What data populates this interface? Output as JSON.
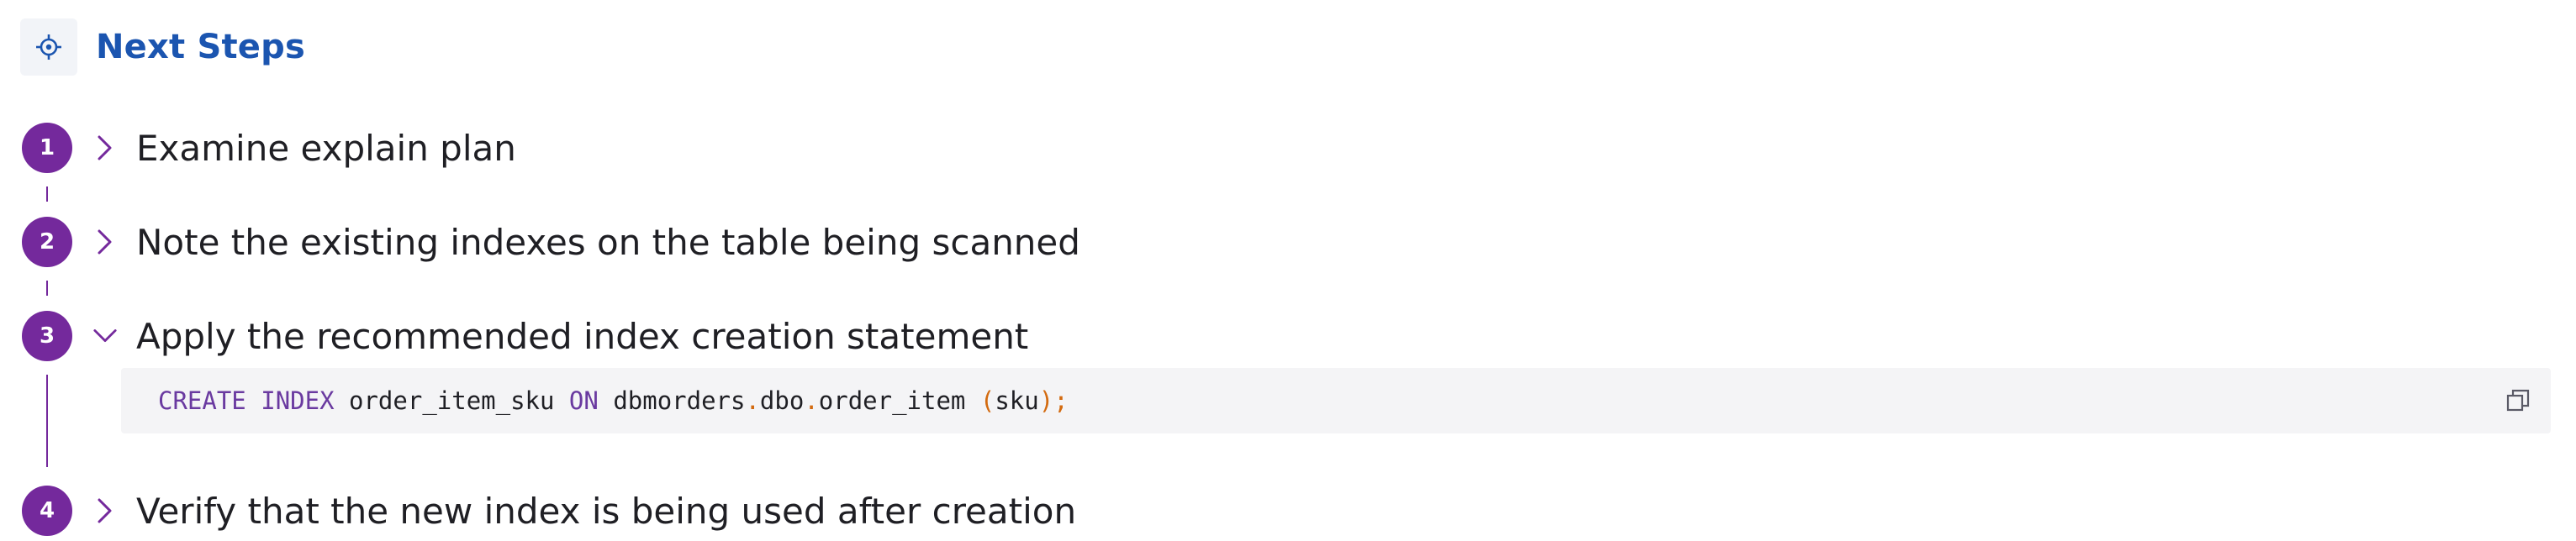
{
  "header": {
    "title": "Next Steps",
    "icon": "target-icon"
  },
  "colors": {
    "accent_purple": "#74299c",
    "title_blue": "#1b55b0",
    "code_background": "#f4f4f6",
    "keyword": "#6a3aa0",
    "punctuation": "#d36a0f"
  },
  "steps": [
    {
      "number": "1",
      "label": "Examine explain plan",
      "expanded": false,
      "chevron": "chevron-right-icon"
    },
    {
      "number": "2",
      "label": "Note the existing indexes on the table being scanned",
      "expanded": false,
      "chevron": "chevron-right-icon"
    },
    {
      "number": "3",
      "label": "Apply the recommended index creation statement",
      "expanded": true,
      "chevron": "chevron-down-icon"
    },
    {
      "number": "4",
      "label": "Verify that the new index is being used after creation",
      "expanded": false,
      "chevron": "chevron-right-icon"
    }
  ],
  "code": {
    "tokens": {
      "kw_create": "CREATE",
      "kw_index": "INDEX",
      "index_name": "order_item_sku",
      "kw_on": "ON",
      "db": "dbmorders",
      "dot1": ".",
      "schema": "dbo",
      "dot2": ".",
      "table": "order_item",
      "paren_open": "(",
      "column": "sku",
      "paren_close": ")",
      "semicolon": ";"
    },
    "copy_icon": "copy-icon"
  }
}
